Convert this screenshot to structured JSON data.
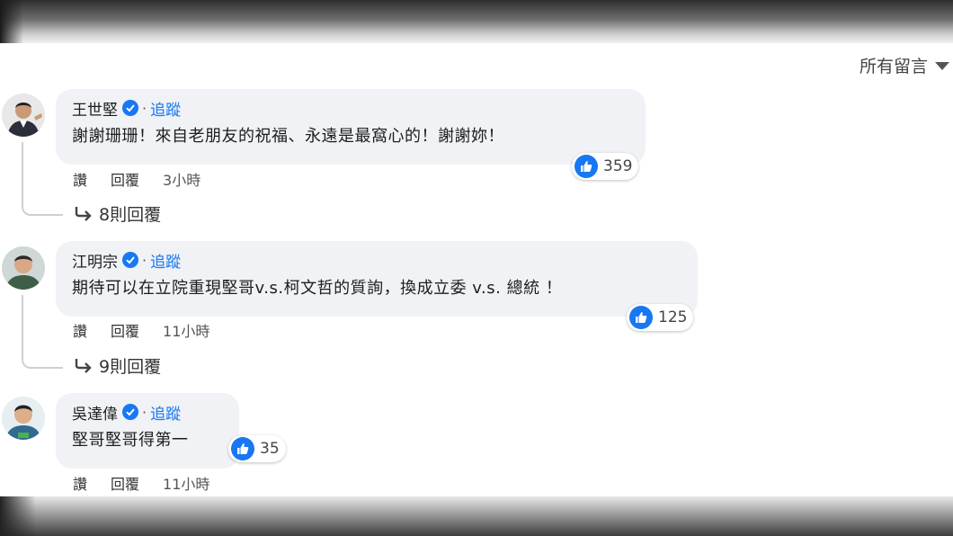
{
  "sort_label": "所有留言",
  "comments": [
    {
      "name": "王世堅",
      "follow": "追蹤",
      "separator": "·",
      "text": "謝謝珊珊！來自老朋友的祝福、永遠是最窩心的！謝謝妳！",
      "likes": "359",
      "like_action": "讚",
      "reply_action": "回覆",
      "time": "3小時",
      "replies_label": "8則回覆"
    },
    {
      "name": "江明宗",
      "follow": "追蹤",
      "separator": "·",
      "text": "期待可以在立院重現堅哥v.s.柯文哲的質詢，換成立委 v.s. 總統 ！",
      "likes": "125",
      "like_action": "讚",
      "reply_action": "回覆",
      "time": "11小時",
      "replies_label": "9則回覆"
    },
    {
      "name": "吳達偉",
      "follow": "追蹤",
      "separator": "·",
      "text": "堅哥堅哥得第一",
      "likes": "35",
      "like_action": "讚",
      "reply_action": "回覆",
      "time": "11小時"
    }
  ],
  "colors": {
    "accent": "#1877f2",
    "bubble": "#f0f2f5"
  }
}
